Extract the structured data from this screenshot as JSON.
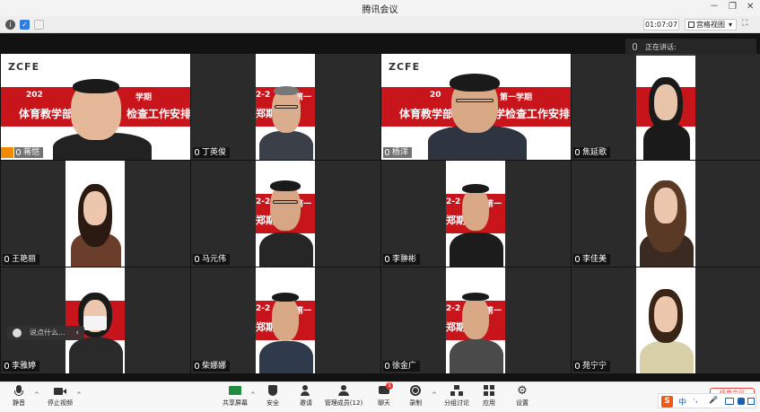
{
  "window": {
    "title": "腾讯会议",
    "min_glyph": "－",
    "restore_glyph": "❐",
    "close_glyph": "✕"
  },
  "infobar": {
    "timer": "01:07:07",
    "view_label": "宫格视图",
    "view_caret": "▾",
    "fullscreen_glyph": "⛶"
  },
  "speaking": {
    "label": "正在讲话:"
  },
  "chat_float": {
    "placeholder": "说点什么...",
    "arrow": "‹"
  },
  "slide": {
    "logo": "ZCFE",
    "line1_a": "202",
    "line1_b": "学期",
    "line2": "体育教学部",
    "line2_b": "检查工作安排",
    "w1": "2-2",
    "w2": "第一",
    "w3": "郑期",
    "w4": "查",
    "yang_line1_a": "20",
    "yang_line1_b": "第一学期",
    "yang_line2_a": "体育教学部",
    "yang_line2_b": "学检查工作安排"
  },
  "participants": [
    {
      "name": "蒋恺",
      "active": true
    },
    {
      "name": "丁英俊"
    },
    {
      "name": "杨洋"
    },
    {
      "name": "焦延歌"
    },
    {
      "name": "王艳丽"
    },
    {
      "name": "马元伟"
    },
    {
      "name": "李翀彬"
    },
    {
      "name": "李佳美"
    },
    {
      "name": "李雅婷"
    },
    {
      "name": "柴娜娜"
    },
    {
      "name": "徐金广"
    },
    {
      "name": "苑宁宁"
    }
  ],
  "toolbar": {
    "mute": "静音",
    "video": "停止视频",
    "share": "共享屏幕",
    "security": "安全",
    "invite": "邀请",
    "members": "管理成员(12)",
    "chat": "聊天",
    "chat_badge": "1",
    "record": "录制",
    "breakout": "分组讨论",
    "apps": "应用",
    "settings": "设置",
    "end": "结束会议",
    "caret": "^"
  },
  "ime": {
    "logo": "S",
    "lang": "中",
    "punct": "·,",
    "mic": "🎤"
  },
  "colors": {
    "slide_red": "#c8151b",
    "active_outline": "#f0a020",
    "stage_bg": "#121212"
  }
}
